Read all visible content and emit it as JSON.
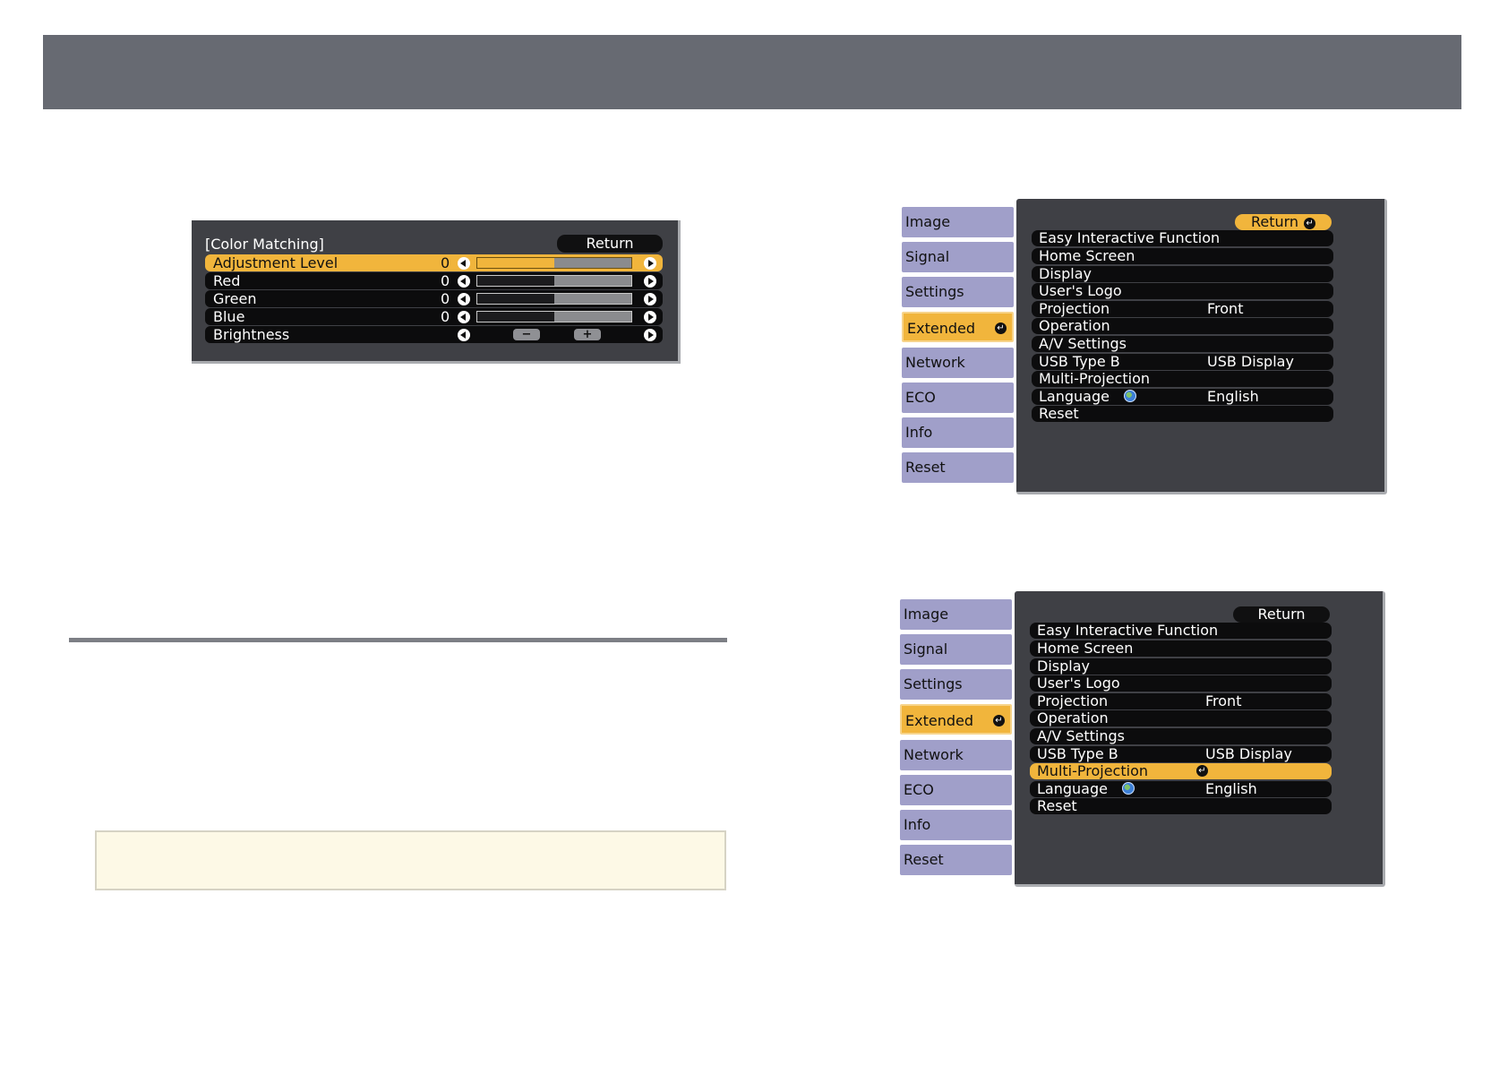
{
  "color_matching": {
    "title": "[Color Matching]",
    "return_label": "Return",
    "rows": [
      {
        "label": "Adjustment Level",
        "value": "0",
        "level": 0.5,
        "selected": true
      },
      {
        "label": "Red",
        "value": "0",
        "level": 0.5
      },
      {
        "label": "Green",
        "value": "0",
        "level": 0.5
      },
      {
        "label": "Blue",
        "value": "0",
        "level": 0.5
      },
      {
        "label": "Brightness",
        "value": ""
      }
    ],
    "minus_label": "−",
    "plus_label": "+"
  },
  "menu_top": {
    "return_label": "Return",
    "tabs": [
      "Image",
      "Signal",
      "Settings",
      "Extended",
      "Network",
      "ECO",
      "Info",
      "Reset"
    ],
    "active_tab": "Extended",
    "items": [
      {
        "label": "Easy Interactive Function",
        "value": ""
      },
      {
        "label": "Home Screen",
        "value": ""
      },
      {
        "label": "Display",
        "value": ""
      },
      {
        "label": "User's Logo",
        "value": ""
      },
      {
        "label": "Projection",
        "value": "Front"
      },
      {
        "label": "Operation",
        "value": ""
      },
      {
        "label": "A/V Settings",
        "value": ""
      },
      {
        "label": "USB Type B",
        "value": "USB Display"
      },
      {
        "label": "Multi-Projection",
        "value": ""
      },
      {
        "label": "Language",
        "value": "English"
      },
      {
        "label": "Reset",
        "value": ""
      }
    ]
  },
  "menu_bottom": {
    "return_label": "Return",
    "tabs": [
      "Image",
      "Signal",
      "Settings",
      "Extended",
      "Network",
      "ECO",
      "Info",
      "Reset"
    ],
    "active_tab": "Extended",
    "items": [
      {
        "label": "Easy Interactive Function",
        "value": ""
      },
      {
        "label": "Home Screen",
        "value": ""
      },
      {
        "label": "Display",
        "value": ""
      },
      {
        "label": "User's Logo",
        "value": ""
      },
      {
        "label": "Projection",
        "value": "Front"
      },
      {
        "label": "Operation",
        "value": ""
      },
      {
        "label": "A/V Settings",
        "value": ""
      },
      {
        "label": "USB Type B",
        "value": "USB Display"
      },
      {
        "label": "Multi-Projection",
        "value": ""
      },
      {
        "label": "Language",
        "value": "English"
      },
      {
        "label": "Reset",
        "value": ""
      }
    ],
    "selected_item": "Multi-Projection"
  },
  "colors": {
    "highlight": "#f1b53c",
    "tab_bg": "#a09fc9",
    "panel_bg": "#3f4045",
    "header_band": "#676a72"
  }
}
